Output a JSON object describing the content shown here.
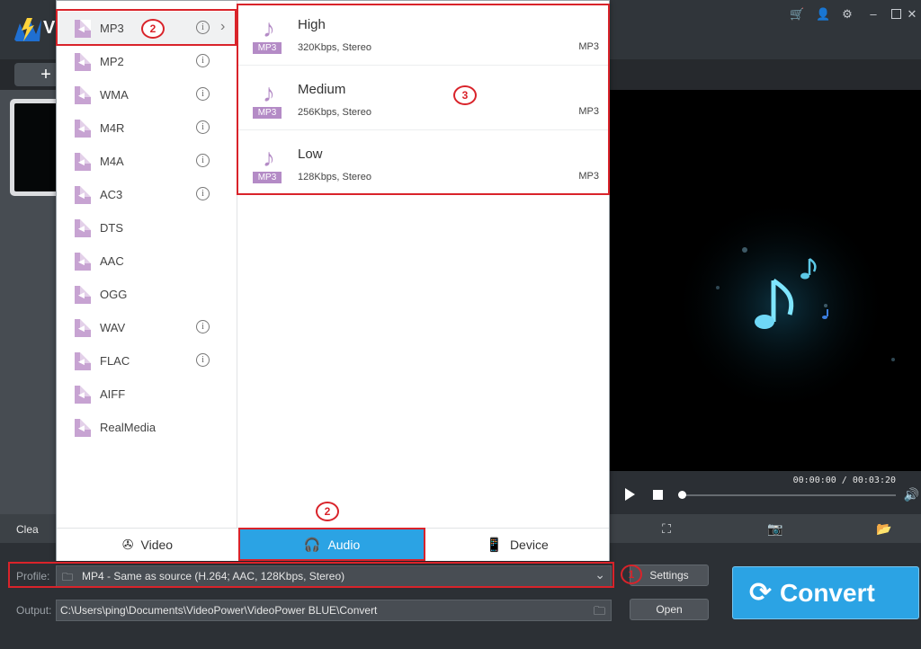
{
  "app": {
    "logo_letter": "V",
    "add_button_icon": "+",
    "window_controls": [
      "cart-icon",
      "user-icon",
      "settings-icon",
      "minimize-icon",
      "maximize-icon",
      "close-icon"
    ]
  },
  "preview": {
    "time": "00:00:00 / 00:03:20",
    "progress": 0.0
  },
  "bottom_tools": {
    "clear_label": "Clea"
  },
  "profile": {
    "label": "Profile:",
    "value": "MP4 - Same as source (H.264; AAC, 128Kbps, Stereo)",
    "settings_label": "Settings"
  },
  "output": {
    "label": "Output:",
    "path": "C:\\Users\\ping\\Documents\\VideoPower\\VideoPower BLUE\\Convert",
    "open_label": "Open"
  },
  "convert": {
    "label": "Convert"
  },
  "formats": [
    {
      "label": "MP3",
      "info": true,
      "selected": true
    },
    {
      "label": "MP2",
      "info": true
    },
    {
      "label": "WMA",
      "info": true
    },
    {
      "label": "M4R",
      "info": true
    },
    {
      "label": "M4A",
      "info": true
    },
    {
      "label": "AC3",
      "info": true
    },
    {
      "label": "DTS",
      "info": false
    },
    {
      "label": "AAC",
      "info": false
    },
    {
      "label": "OGG",
      "info": false
    },
    {
      "label": "WAV",
      "info": true
    },
    {
      "label": "FLAC",
      "info": true
    },
    {
      "label": "AIFF",
      "info": false
    },
    {
      "label": "RealMedia",
      "info": false
    }
  ],
  "presets": [
    {
      "name": "High",
      "spec": "320Kbps, Stereo",
      "format": "MP3",
      "badge": "MP3"
    },
    {
      "name": "Medium",
      "spec": "256Kbps, Stereo",
      "format": "MP3",
      "badge": "MP3"
    },
    {
      "name": "Low",
      "spec": "128Kbps, Stereo",
      "format": "MP3",
      "badge": "MP3"
    }
  ],
  "tabs": [
    {
      "label": "Video",
      "icon": "film-reel-icon"
    },
    {
      "label": "Audio",
      "icon": "headphones-icon",
      "active": true
    },
    {
      "label": "Device",
      "icon": "devices-icon"
    }
  ],
  "annotations": {
    "step_format": "2",
    "step_tab": "2",
    "step_preset": "3",
    "step_profile": "1"
  },
  "colors": {
    "accent": "#2ba3e4",
    "annotation": "#d9232a",
    "format_icon": "#c7a3d2"
  }
}
